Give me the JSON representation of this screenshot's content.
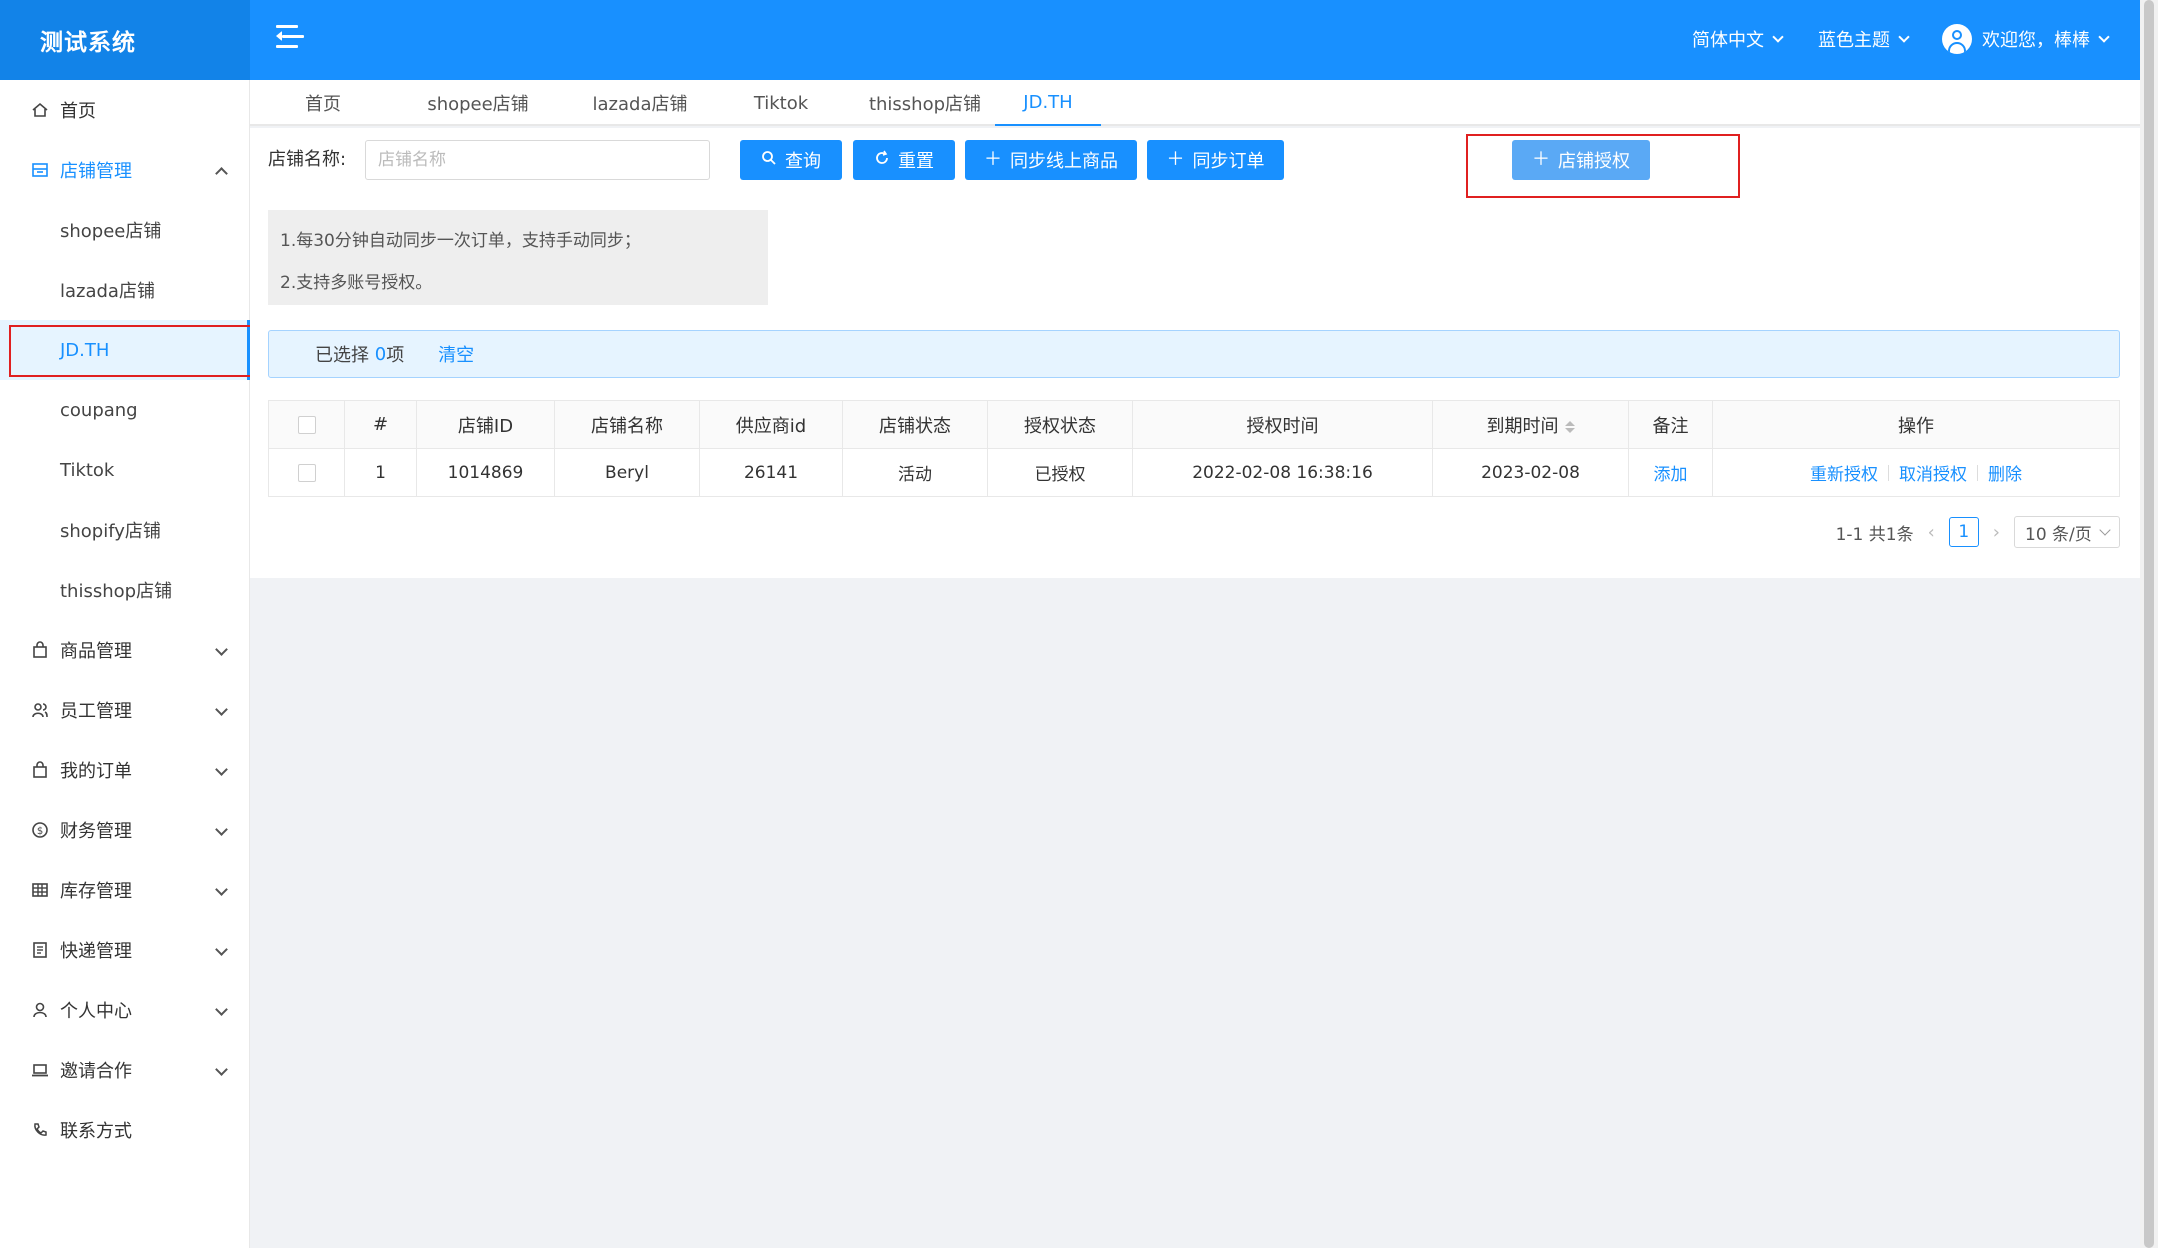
{
  "app": {
    "title": "测试系统"
  },
  "header": {
    "language": "简体中文",
    "theme": "蓝色主题",
    "user_greeting": "欢迎您，棒棒"
  },
  "sidebar": {
    "items": [
      {
        "label": "首页",
        "icon": "home-icon"
      },
      {
        "label": "店铺管理",
        "icon": "store-icon"
      },
      {
        "label": "商品管理",
        "icon": "bag-icon"
      },
      {
        "label": "员工管理",
        "icon": "users-icon"
      },
      {
        "label": "我的订单",
        "icon": "bag-icon"
      },
      {
        "label": "财务管理",
        "icon": "dollar-circle-icon"
      },
      {
        "label": "库存管理",
        "icon": "table-icon"
      },
      {
        "label": "快递管理",
        "icon": "list-icon"
      },
      {
        "label": "个人中心",
        "icon": "user-icon"
      },
      {
        "label": "邀请合作",
        "icon": "laptop-icon"
      },
      {
        "label": "联系方式",
        "icon": "phone-icon"
      }
    ],
    "sub_items": [
      "shopee店铺",
      "lazada店铺",
      "JD.TH",
      "coupang",
      "Tiktok",
      "shopify店铺",
      "thisshop店铺"
    ]
  },
  "tabs": [
    "首页",
    "shopee店铺",
    "lazada店铺",
    "Tiktok",
    "thisshop店铺",
    "JD.TH"
  ],
  "search": {
    "label": "店铺名称:",
    "placeholder": "店铺名称",
    "query_label": "查询",
    "reset_label": "重置",
    "sync_products_label": "同步线上商品",
    "sync_orders_label": "同步订单",
    "authorize_label": "店铺授权"
  },
  "tips": [
    "1.每30分钟自动同步一次订单，支持手动同步；",
    "2.支持多账号授权。"
  ],
  "selection": {
    "prefix": "已选择 ",
    "count": "0",
    "suffix": "项",
    "clear": "清空"
  },
  "table": {
    "columns": [
      "#",
      "店铺ID",
      "店铺名称",
      "供应商id",
      "店铺状态",
      "授权状态",
      "授权时间",
      "到期时间",
      "备注",
      "操作"
    ],
    "rows": [
      {
        "index": "1",
        "store_id": "1014869",
        "store_name": "Beryl",
        "supplier_id": "26141",
        "store_status": "活动",
        "auth_status": "已授权",
        "auth_time": "2022-02-08 16:38:16",
        "expire_time": "2023-02-08",
        "remark": "添加",
        "actions": [
          "重新授权",
          "取消授权",
          "删除"
        ]
      }
    ]
  },
  "pagination": {
    "summary": "1-1 共1条",
    "current_page": "1",
    "page_size": "10 条/页"
  },
  "colors": {
    "primary": "#1890ff",
    "highlight_box": "#e02020"
  }
}
